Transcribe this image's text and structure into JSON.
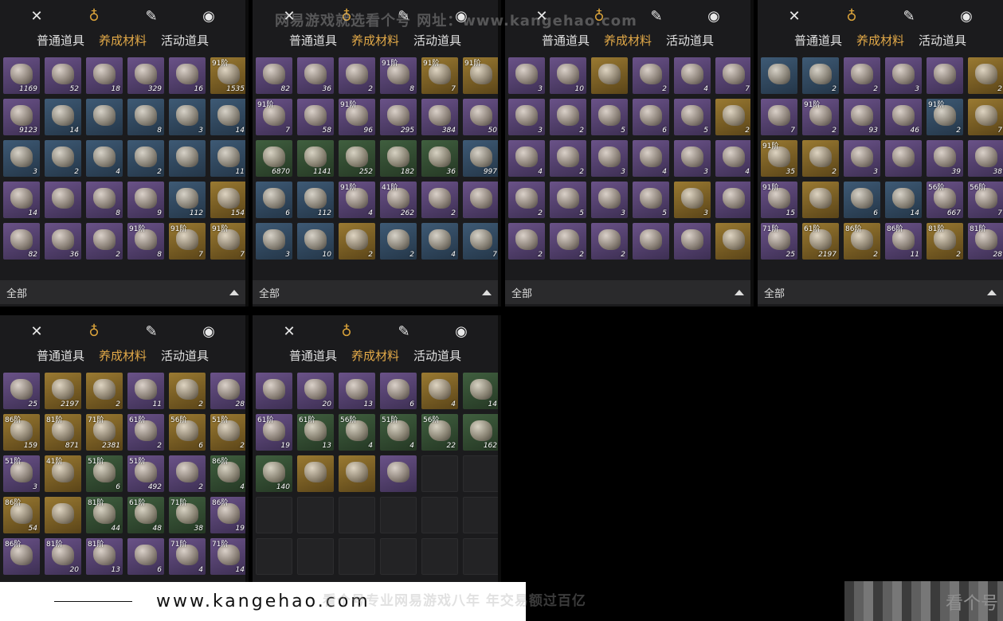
{
  "watermark_top": "网易游戏就选看个号  网址：www.kangehao.com",
  "banner": {
    "url": "www.kangehao.com"
  },
  "slogan": "看个号专业网易游戏八年  年交易额过百亿",
  "corner_watermark": "看个号",
  "tabs": {
    "normal": "普通道具",
    "material": "养成材料",
    "event": "活动道具"
  },
  "filter": {
    "label": "全部"
  },
  "topbar_icons": [
    "crossed-swords-icon",
    "pouch-icon",
    "scroll-icon",
    "map-pin-icon"
  ],
  "colors": {
    "active_tab": "#e2a948",
    "bg": "#1b1b1d",
    "filter_bg": "#2a2a2c"
  },
  "panels": [
    {
      "filter": true,
      "items": [
        {
          "r": "purple",
          "c": "1169"
        },
        {
          "r": "purple",
          "c": "52"
        },
        {
          "r": "purple",
          "c": "18"
        },
        {
          "r": "purple",
          "c": "329"
        },
        {
          "r": "purple",
          "c": "16"
        },
        {
          "r": "gold",
          "l": "91阶",
          "c": "1535"
        },
        {
          "r": "purple",
          "c": "9123"
        },
        {
          "r": "blue",
          "c": "14"
        },
        {
          "r": "blue",
          "c": ""
        },
        {
          "r": "blue",
          "c": "8"
        },
        {
          "r": "blue",
          "c": "3"
        },
        {
          "r": "blue",
          "c": "14"
        },
        {
          "r": "blue",
          "c": "3"
        },
        {
          "r": "blue",
          "c": "2"
        },
        {
          "r": "blue",
          "c": "4"
        },
        {
          "r": "blue",
          "c": "2"
        },
        {
          "r": "blue",
          "c": ""
        },
        {
          "r": "blue",
          "c": "11"
        },
        {
          "r": "purple",
          "c": "14"
        },
        {
          "r": "purple",
          "c": ""
        },
        {
          "r": "purple",
          "c": "8"
        },
        {
          "r": "purple",
          "c": "9"
        },
        {
          "r": "blue",
          "c": "112"
        },
        {
          "r": "gold",
          "c": "154"
        },
        {
          "r": "purple",
          "c": "82"
        },
        {
          "r": "purple",
          "c": "36"
        },
        {
          "r": "purple",
          "c": "2"
        },
        {
          "r": "purple",
          "l": "91阶",
          "c": "8"
        },
        {
          "r": "gold",
          "l": "91阶",
          "c": "7"
        },
        {
          "r": "gold",
          "l": "91阶",
          "c": "7"
        }
      ]
    },
    {
      "filter": true,
      "items": [
        {
          "r": "purple",
          "c": "82"
        },
        {
          "r": "purple",
          "c": "36"
        },
        {
          "r": "purple",
          "c": "2"
        },
        {
          "r": "purple",
          "l": "91阶",
          "c": "8"
        },
        {
          "r": "gold",
          "l": "91阶",
          "c": "7"
        },
        {
          "r": "gold",
          "l": "91阶",
          "c": ""
        },
        {
          "r": "purple",
          "l": "91阶",
          "c": "7"
        },
        {
          "r": "purple",
          "c": "58"
        },
        {
          "r": "purple",
          "l": "91阶",
          "c": "96"
        },
        {
          "r": "purple",
          "c": "295"
        },
        {
          "r": "purple",
          "c": "384"
        },
        {
          "r": "purple",
          "c": "50"
        },
        {
          "r": "green",
          "c": "6870"
        },
        {
          "r": "green",
          "c": "1141"
        },
        {
          "r": "green",
          "c": "252"
        },
        {
          "r": "green",
          "c": "182"
        },
        {
          "r": "green",
          "c": "36"
        },
        {
          "r": "blue",
          "c": "997"
        },
        {
          "r": "blue",
          "c": "6"
        },
        {
          "r": "blue",
          "c": "112"
        },
        {
          "r": "purple",
          "l": "91阶",
          "c": "4"
        },
        {
          "r": "purple",
          "l": "41阶",
          "c": "262"
        },
        {
          "r": "purple",
          "c": "2"
        },
        {
          "r": "purple",
          "c": ""
        },
        {
          "r": "blue",
          "c": "3"
        },
        {
          "r": "blue",
          "c": "10"
        },
        {
          "r": "gold",
          "c": "2"
        },
        {
          "r": "blue",
          "c": "2"
        },
        {
          "r": "blue",
          "c": "4"
        },
        {
          "r": "blue",
          "c": "7"
        }
      ]
    },
    {
      "filter": true,
      "items": [
        {
          "r": "purple",
          "c": "3"
        },
        {
          "r": "purple",
          "c": "10"
        },
        {
          "r": "gold",
          "c": ""
        },
        {
          "r": "purple",
          "c": "2"
        },
        {
          "r": "purple",
          "c": "4"
        },
        {
          "r": "purple",
          "c": "7"
        },
        {
          "r": "purple",
          "c": "3"
        },
        {
          "r": "purple",
          "c": "2"
        },
        {
          "r": "purple",
          "c": "5"
        },
        {
          "r": "purple",
          "c": "6"
        },
        {
          "r": "purple",
          "c": "5"
        },
        {
          "r": "gold",
          "c": "2"
        },
        {
          "r": "purple",
          "c": "4"
        },
        {
          "r": "purple",
          "c": "2"
        },
        {
          "r": "purple",
          "c": "3"
        },
        {
          "r": "purple",
          "c": "4"
        },
        {
          "r": "purple",
          "c": "3"
        },
        {
          "r": "purple",
          "c": "4"
        },
        {
          "r": "purple",
          "c": "2"
        },
        {
          "r": "purple",
          "c": "5"
        },
        {
          "r": "purple",
          "c": "3"
        },
        {
          "r": "purple",
          "c": "5"
        },
        {
          "r": "gold",
          "c": "3"
        },
        {
          "r": "purple",
          "c": ""
        },
        {
          "r": "purple",
          "c": "2"
        },
        {
          "r": "purple",
          "c": "2"
        },
        {
          "r": "purple",
          "c": "2"
        },
        {
          "r": "purple",
          "c": ""
        },
        {
          "r": "purple",
          "c": ""
        },
        {
          "r": "gold",
          "c": ""
        }
      ]
    },
    {
      "filter": true,
      "items": [
        {
          "r": "blue",
          "c": ""
        },
        {
          "r": "blue",
          "c": "2"
        },
        {
          "r": "purple",
          "c": "2"
        },
        {
          "r": "purple",
          "c": "3"
        },
        {
          "r": "purple",
          "c": ""
        },
        {
          "r": "gold",
          "c": "2"
        },
        {
          "r": "purple",
          "c": "7"
        },
        {
          "r": "purple",
          "l": "91阶",
          "c": "2"
        },
        {
          "r": "purple",
          "c": "93"
        },
        {
          "r": "purple",
          "c": "46"
        },
        {
          "r": "blue",
          "l": "91阶",
          "c": "2"
        },
        {
          "r": "gold",
          "c": "7"
        },
        {
          "r": "gold",
          "l": "91阶",
          "c": "35"
        },
        {
          "r": "gold",
          "c": "2"
        },
        {
          "r": "purple",
          "c": "3"
        },
        {
          "r": "purple",
          "c": ""
        },
        {
          "r": "purple",
          "c": "39"
        },
        {
          "r": "purple",
          "c": "38"
        },
        {
          "r": "purple",
          "l": "91阶",
          "c": "15"
        },
        {
          "r": "gold",
          "c": ""
        },
        {
          "r": "blue",
          "c": "6"
        },
        {
          "r": "blue",
          "c": "14"
        },
        {
          "r": "purple",
          "l": "56阶",
          "c": "667"
        },
        {
          "r": "purple",
          "l": "56阶",
          "c": "7"
        },
        {
          "r": "purple",
          "l": "71阶",
          "c": "25"
        },
        {
          "r": "gold",
          "l": "61阶",
          "c": "2197"
        },
        {
          "r": "gold",
          "l": "86阶",
          "c": "2"
        },
        {
          "r": "purple",
          "l": "86阶",
          "c": "11"
        },
        {
          "r": "gold",
          "l": "81阶",
          "c": "2"
        },
        {
          "r": "purple",
          "l": "81阶",
          "c": "28"
        }
      ]
    },
    {
      "filter": false,
      "items": [
        {
          "r": "purple",
          "c": "25"
        },
        {
          "r": "gold",
          "c": "2197"
        },
        {
          "r": "gold",
          "c": "2"
        },
        {
          "r": "purple",
          "c": "11"
        },
        {
          "r": "gold",
          "c": "2"
        },
        {
          "r": "purple",
          "c": "28"
        },
        {
          "r": "gold",
          "l": "86阶",
          "c": "159"
        },
        {
          "r": "gold",
          "l": "81阶",
          "c": "871"
        },
        {
          "r": "gold",
          "l": "71阶",
          "c": "2381"
        },
        {
          "r": "purple",
          "l": "61阶",
          "c": "2"
        },
        {
          "r": "gold",
          "l": "56阶",
          "c": "6"
        },
        {
          "r": "gold",
          "l": "51阶",
          "c": "2"
        },
        {
          "r": "purple",
          "l": "51阶",
          "c": "3"
        },
        {
          "r": "gold",
          "l": "41阶",
          "c": ""
        },
        {
          "r": "green",
          "l": "51阶",
          "c": "6"
        },
        {
          "r": "purple",
          "l": "51阶",
          "c": "492"
        },
        {
          "r": "purple",
          "c": "2"
        },
        {
          "r": "green",
          "l": "86阶",
          "c": "4"
        },
        {
          "r": "gold",
          "l": "86阶",
          "c": "54"
        },
        {
          "r": "gold",
          "c": ""
        },
        {
          "r": "green",
          "l": "81阶",
          "c": "44"
        },
        {
          "r": "green",
          "l": "61阶",
          "c": "48"
        },
        {
          "r": "green",
          "l": "71阶",
          "c": "38"
        },
        {
          "r": "purple",
          "l": "86阶",
          "c": "19"
        },
        {
          "r": "purple",
          "l": "86阶",
          "c": ""
        },
        {
          "r": "purple",
          "l": "81阶",
          "c": "20"
        },
        {
          "r": "purple",
          "l": "81阶",
          "c": "13"
        },
        {
          "r": "purple",
          "c": "6"
        },
        {
          "r": "purple",
          "l": "71阶",
          "c": "4"
        },
        {
          "r": "purple",
          "l": "71阶",
          "c": "14"
        }
      ]
    },
    {
      "filter": false,
      "items": [
        {
          "r": "purple",
          "c": ""
        },
        {
          "r": "purple",
          "c": "20"
        },
        {
          "r": "purple",
          "c": "13"
        },
        {
          "r": "purple",
          "c": "6"
        },
        {
          "r": "gold",
          "c": "4"
        },
        {
          "r": "green",
          "c": "14"
        },
        {
          "r": "purple",
          "l": "61阶",
          "c": "19"
        },
        {
          "r": "green",
          "l": "61阶",
          "c": "13"
        },
        {
          "r": "green",
          "l": "56阶",
          "c": "4"
        },
        {
          "r": "green",
          "l": "51阶",
          "c": "4"
        },
        {
          "r": "green",
          "l": "56阶",
          "c": "22"
        },
        {
          "r": "green",
          "c": "162"
        },
        {
          "r": "green",
          "c": "140"
        },
        {
          "r": "gold",
          "c": ""
        },
        {
          "r": "gold",
          "c": ""
        },
        {
          "r": "purple",
          "c": ""
        },
        {
          "r": "empty",
          "c": ""
        },
        {
          "r": "empty",
          "c": ""
        },
        {
          "r": "empty",
          "c": ""
        },
        {
          "r": "empty",
          "c": ""
        },
        {
          "r": "empty",
          "c": ""
        },
        {
          "r": "empty",
          "c": ""
        },
        {
          "r": "empty",
          "c": ""
        },
        {
          "r": "empty",
          "c": ""
        },
        {
          "r": "empty",
          "c": ""
        },
        {
          "r": "empty",
          "c": ""
        },
        {
          "r": "empty",
          "c": ""
        },
        {
          "r": "empty",
          "c": ""
        },
        {
          "r": "empty",
          "c": ""
        },
        {
          "r": "empty",
          "c": ""
        }
      ]
    }
  ]
}
